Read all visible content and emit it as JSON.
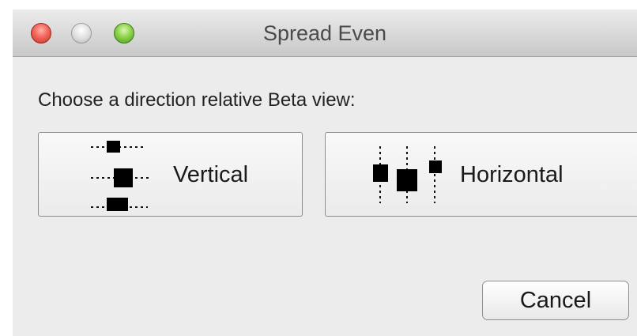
{
  "window": {
    "title": "Spread Even"
  },
  "titlebar": {
    "buttons": [
      "close",
      "minimize",
      "zoom"
    ]
  },
  "dialog": {
    "prompt": "Choose a direction relative Beta view:",
    "options": [
      {
        "label": "Vertical",
        "icon": "spread-vertical-icon"
      },
      {
        "label": "Horizontal",
        "icon": "spread-horizontal-icon"
      }
    ],
    "cancel_label": "Cancel"
  }
}
